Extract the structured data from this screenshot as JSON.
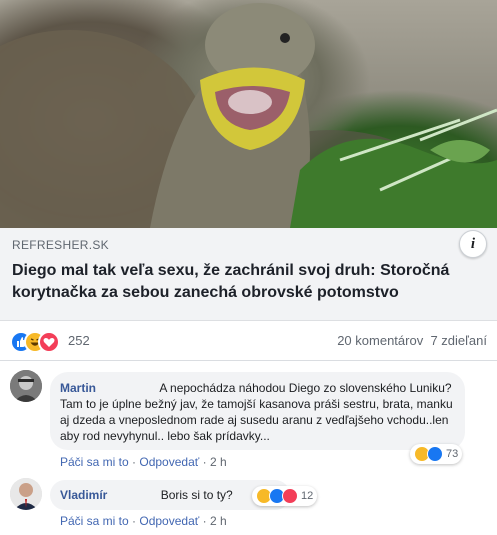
{
  "post": {
    "link_domain": "REFRESHER.SK",
    "link_title": "Diego mal tak veľa sexu, že zachránil svoj druh: Storočná korytnačka za sebou zanechá obrovské potomstvo",
    "info_label": "i",
    "reaction_count": "252",
    "comments_count": "20 komentárov",
    "shares_count": "7 zdieľaní"
  },
  "comments": [
    {
      "author": "Martin",
      "text": "A nepochádza náhodou Diego zo slovenského Luniku? Tam to je úplne bežný jav, že tamojší kasanova práši sestru, brata, manku aj dzeda a vneposlednom rade aj susedu aranu z vedľajšeho vchodu..len aby rod nevyhynul.. lebo šak prídavky...",
      "like": "Páči sa mi to",
      "reply": "Odpovedať",
      "time": "2 h",
      "reaction_count": "73"
    },
    {
      "author": "Vladimír",
      "text": "Boris si to ty?",
      "like": "Páči sa mi to",
      "reply": "Odpovedať",
      "time": "2 h",
      "reaction_count": "12"
    }
  ],
  "colors": {
    "like": "#1877f2",
    "haha": "#f7b928",
    "love": "#f33e58",
    "link": "#385898"
  }
}
